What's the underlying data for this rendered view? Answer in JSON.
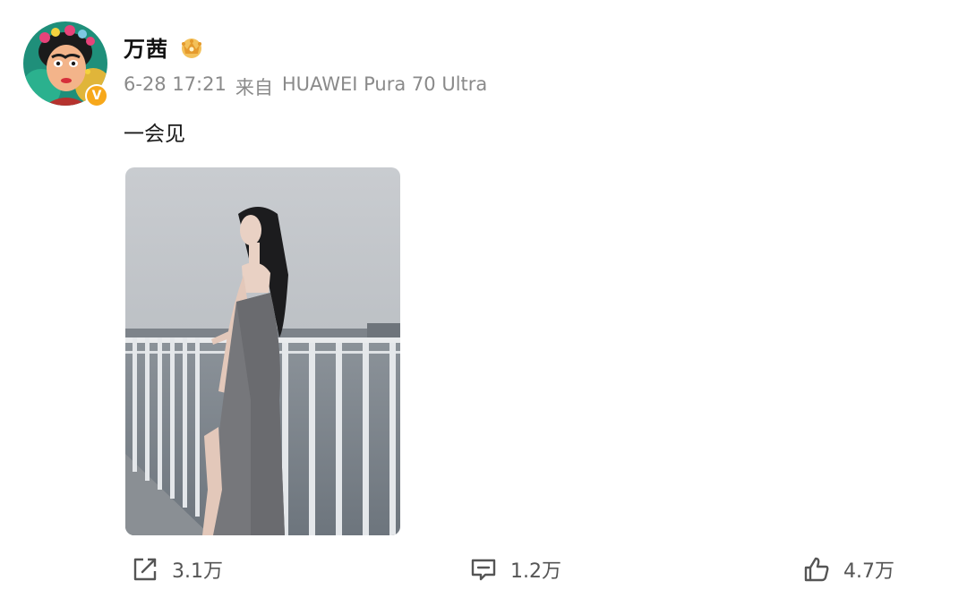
{
  "post": {
    "username": "万茜",
    "timestamp": "6-28 17:21",
    "source_prefix": "来自",
    "source_device": "HUAWEI Pura 70 Ultra",
    "text": "一会见",
    "avatar_icon": "cartoon-avatar",
    "verified_badge": "V",
    "verified_color": "#f7a81b",
    "member_badge_icon": "crown-badge-icon"
  },
  "actions": {
    "share_count": "3.1万",
    "comment_count": "1.2万",
    "like_count": "4.7万"
  }
}
